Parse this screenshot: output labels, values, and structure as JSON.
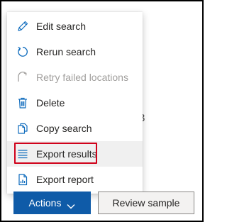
{
  "background": {
    "fragment_text": "3"
  },
  "menu": {
    "items": [
      {
        "label": "Edit search",
        "icon": "pencil-icon",
        "enabled": true
      },
      {
        "label": "Rerun search",
        "icon": "refresh-icon",
        "enabled": true
      },
      {
        "label": "Retry failed locations",
        "icon": "retry-icon",
        "enabled": false
      },
      {
        "label": "Delete",
        "icon": "trash-icon",
        "enabled": true
      },
      {
        "label": "Copy search",
        "icon": "copy-icon",
        "enabled": true
      },
      {
        "label": "Export results",
        "icon": "list-icon",
        "enabled": true,
        "highlighted": true
      },
      {
        "label": "Export report",
        "icon": "report-icon",
        "enabled": true
      }
    ]
  },
  "buttons": {
    "actions_label": "Actions",
    "review_label": "Review sample"
  },
  "colors": {
    "accent": "#0f5ba8",
    "icon_blue": "#0f6cbd",
    "focus_outline": "#d0021b",
    "disabled_text": "#a19f9d"
  }
}
